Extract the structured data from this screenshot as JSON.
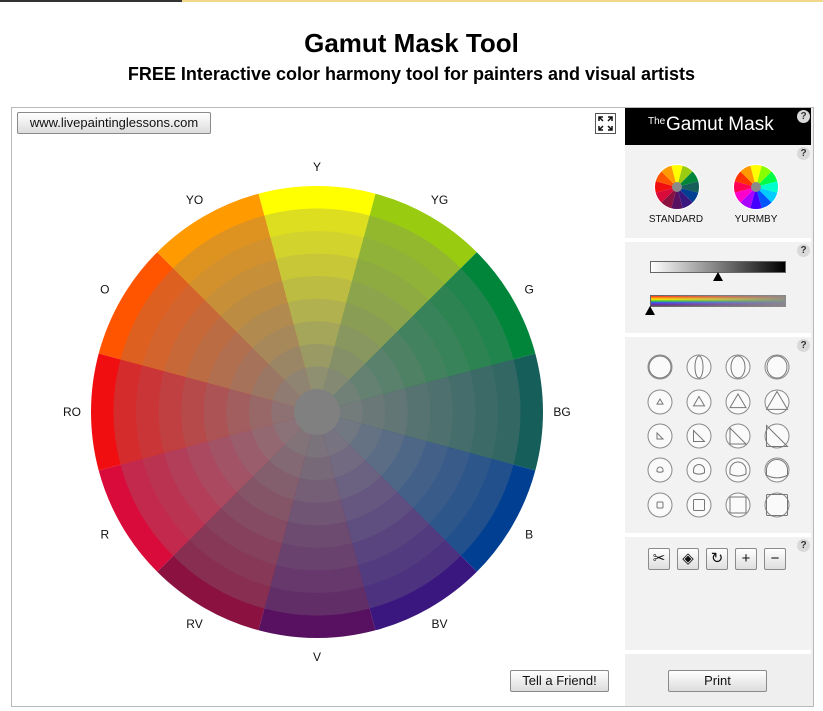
{
  "header": {
    "title": "Gamut Mask Tool",
    "subtitle": "FREE Interactive color harmony tool for painters and visual artists"
  },
  "stage": {
    "site_button": "www.livepaintinglessons.com",
    "fullscreen_icon": "expand-arrows-icon",
    "tell_friend_button": "Tell a Friend!",
    "print_button": "Print"
  },
  "wheel": {
    "labels": [
      "Y",
      "YG",
      "G",
      "BG",
      "B",
      "BV",
      "V",
      "RV",
      "R",
      "RO",
      "O",
      "YO"
    ],
    "colors": [
      "#ffff00",
      "#99cc11",
      "#00853a",
      "#165e5a",
      "#003f91",
      "#3a167f",
      "#581160",
      "#8a1140",
      "#d90b3a",
      "#f10e10",
      "#ff5500",
      "#ff9a00"
    ],
    "center_color": "#808080",
    "rings": 9
  },
  "panel": {
    "brand_the": "The",
    "brand_name": "Gamut Mask",
    "help_label": "?",
    "wheel_types": [
      {
        "label": "STANDARD",
        "icon": "standard-wheel-icon"
      },
      {
        "label": "YURMBY",
        "icon": "yurmby-wheel-icon"
      }
    ],
    "sliders": {
      "value_slider_icon": "grayscale-slider-icon",
      "hue_slider_icon": "spectrum-slider-icon"
    },
    "mask_shapes": [
      [
        "circle-mask-icon",
        "narrow-ellipse-mask-icon",
        "ellipse-mask-icon",
        "wide-ellipse-mask-icon"
      ],
      [
        "small-triangle-mask-icon",
        "triangle-mask-icon",
        "large-triangle-mask-icon",
        "full-triangle-mask-icon"
      ],
      [
        "small-right-triangle-mask-icon",
        "right-triangle-mask-icon",
        "large-right-triangle-mask-icon",
        "full-right-triangle-mask-icon"
      ],
      [
        "small-dome-mask-icon",
        "dome-mask-icon",
        "large-dome-mask-icon",
        "full-dome-mask-icon"
      ],
      [
        "small-square-mask-icon",
        "square-mask-icon",
        "large-square-mask-icon",
        "full-square-mask-icon"
      ]
    ],
    "tools": [
      {
        "name": "scissors-icon",
        "glyph": "✂"
      },
      {
        "name": "paint-bucket-icon",
        "glyph": "◈"
      },
      {
        "name": "rotate-icon",
        "glyph": "↻"
      },
      {
        "name": "zoom-in-icon",
        "glyph": "+"
      },
      {
        "name": "zoom-out-icon",
        "glyph": "−"
      }
    ]
  }
}
